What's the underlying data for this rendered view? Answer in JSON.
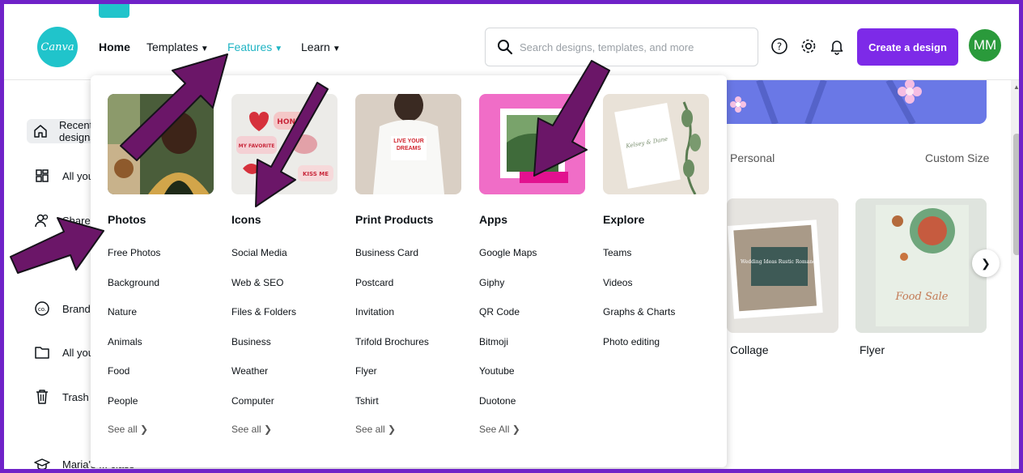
{
  "app": {
    "logo_text": "Canva"
  },
  "topnav": {
    "home": "Home",
    "templates": "Templates",
    "features": "Features",
    "learn": "Learn"
  },
  "search": {
    "placeholder": "Search designs, templates, and more"
  },
  "toolbar": {
    "create_label": "Create a design",
    "avatar_initials": "MM"
  },
  "sidebar": {
    "items": [
      {
        "label": "Recent designs",
        "icon": "home-icon"
      },
      {
        "label": "All your designs",
        "icon": "grid-icon"
      },
      {
        "label": "Shared with you",
        "icon": "people-icon"
      },
      {
        "label": "Brand Kit",
        "icon": "brand-icon"
      },
      {
        "label": "All your folders",
        "icon": "folder-icon"
      },
      {
        "label": "Trash",
        "icon": "trash-icon"
      },
      {
        "label": "Maria's ... class",
        "icon": "graduation-cap-icon"
      }
    ]
  },
  "main": {
    "tabs": [
      "Personal",
      "Custom Size"
    ],
    "cards": [
      {
        "label": "Collage"
      },
      {
        "label": "Flyer"
      }
    ],
    "card_text": {
      "wedding": "Wedding Ideas Rustic Romance",
      "food_sale": "Food Sale"
    }
  },
  "dropdown": {
    "columns": [
      {
        "title": "Photos",
        "items": [
          "Free Photos",
          "Background",
          "Nature",
          "Animals",
          "Food",
          "People"
        ],
        "see_all": "See all ❯"
      },
      {
        "title": "Icons",
        "items": [
          "Social Media",
          "Web & SEO",
          "Files & Folders",
          "Business",
          "Weather",
          "Computer"
        ],
        "see_all": "See all ❯"
      },
      {
        "title": "Print Products",
        "items": [
          "Business Card",
          "Postcard",
          "Invitation",
          "Trifold Brochures",
          "Flyer",
          "Tshirt"
        ],
        "see_all": "See all ❯"
      },
      {
        "title": "Apps",
        "items": [
          "Google Maps",
          "Giphy",
          "QR Code",
          "Bitmoji",
          "Youtube",
          "Duotone"
        ],
        "see_all": "See All ❯"
      },
      {
        "title": "Explore",
        "items": [
          "Teams",
          "Videos",
          "Graphs & Charts",
          "Photo editing"
        ],
        "see_all": ""
      }
    ],
    "image_text": {
      "stickers": [
        "HONEY",
        "MY FAVORITE",
        "KISS ME"
      ],
      "tshirt": "LIVE YOUR DREAMS",
      "invite": "Kelsey & Dane"
    }
  },
  "colors": {
    "accent": "#20c4cb",
    "purple": "#7d2ae8",
    "frame": "#6f22c8",
    "arrow": "#6b1668",
    "avatar": "#2a9a3b"
  }
}
